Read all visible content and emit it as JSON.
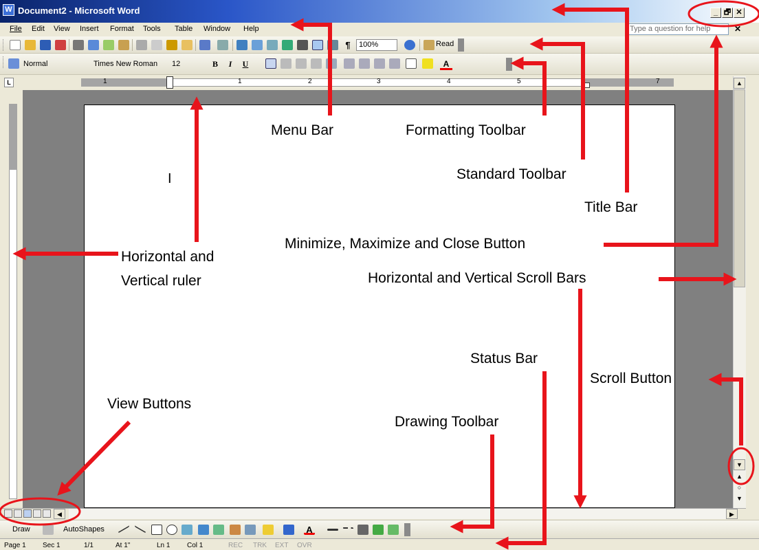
{
  "window": {
    "title": "Document2 - Microsoft Word",
    "minimize": "_",
    "restore": "🗗",
    "close": "✕"
  },
  "menubar": {
    "items": [
      "File",
      "Edit",
      "View",
      "Insert",
      "Format",
      "Tools",
      "Table",
      "Window",
      "Help"
    ],
    "ask_placeholder": "Type a question for help"
  },
  "standard_toolbar": {
    "zoom": "100%",
    "read_label": "Read"
  },
  "formatting_toolbar": {
    "style": "Normal",
    "font": "Times New Roman",
    "size": "12",
    "bold": "B",
    "italic": "I",
    "underline": "U",
    "font_color_glyph": "A"
  },
  "ruler": {
    "numbers": [
      "1",
      "1",
      "2",
      "3",
      "4",
      "5",
      "7"
    ]
  },
  "document": {
    "cursor": "I"
  },
  "drawing_toolbar": {
    "draw_label": "Draw",
    "autoshapes_label": "AutoShapes"
  },
  "status_bar": {
    "page": "Page 1",
    "sec": "Sec 1",
    "pages": "1/1",
    "at": "At 1\"",
    "ln": "Ln 1",
    "col": "Col 1",
    "rec": "REC",
    "trk": "TRK",
    "ext": "EXT",
    "ovr": "OVR"
  },
  "annotations": {
    "menu_bar": "Menu Bar",
    "formatting_toolbar": "Formatting Toolbar",
    "standard_toolbar": "Standard Toolbar",
    "title_bar": "Title Bar",
    "min_max_close": "Minimize, Maximize and Close Button",
    "h_and_v_scroll": "Horizontal and Vertical Scroll Bars",
    "h_and_v_ruler_1": "Horizontal and",
    "h_and_v_ruler_2": "Vertical ruler",
    "status_bar": "Status Bar",
    "scroll_button": "Scroll Button",
    "view_buttons": "View Buttons",
    "drawing_toolbar": "Drawing Toolbar"
  },
  "colors": {
    "annotation_red": "#e8141b",
    "title_blue": "#0a246a",
    "doc_gray": "#808080"
  }
}
